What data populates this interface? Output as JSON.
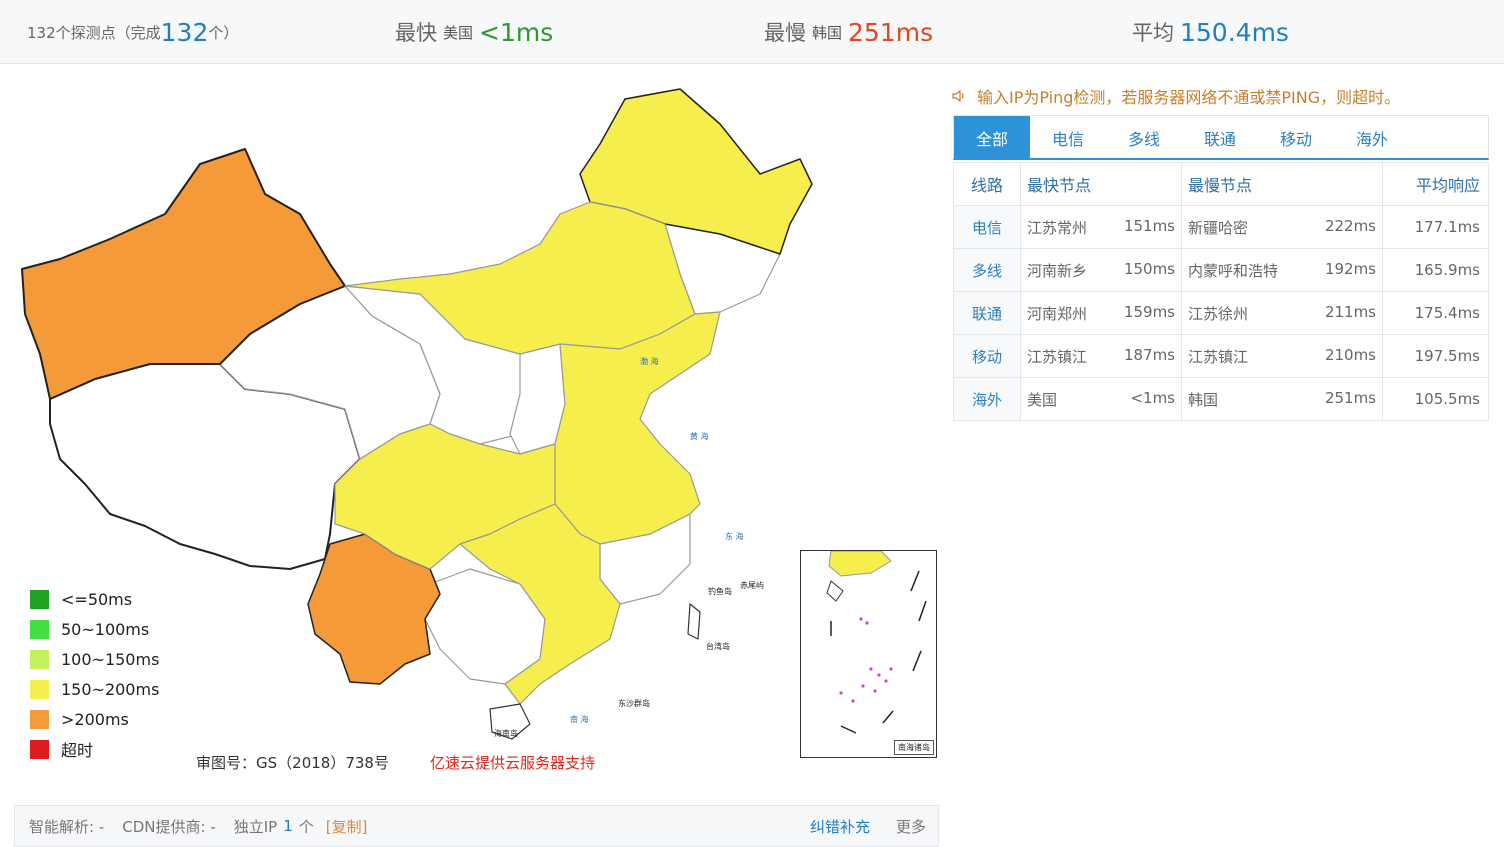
{
  "summary": {
    "probe_text": "132个探测点（完成",
    "probe_done": "132",
    "probe_suffix": "个）",
    "fastest_label": "最快",
    "fastest_country": "美国",
    "fastest_value": "<1ms",
    "slowest_label": "最慢",
    "slowest_country": "韩国",
    "slowest_value": "251ms",
    "avg_label": "平均",
    "avg_value": "150.4ms"
  },
  "legend": [
    {
      "label": "<=50ms",
      "color": "#22a022"
    },
    {
      "label": "50~100ms",
      "color": "#44dd44"
    },
    {
      "label": "100~150ms",
      "color": "#c4f15a"
    },
    {
      "label": "150~200ms",
      "color": "#f5ee4c"
    },
    {
      "label": ">200ms",
      "color": "#f59a38"
    },
    {
      "label": "超时",
      "color": "#e01b1b"
    }
  ],
  "map": {
    "credit": "审图号：GS（2018）738号",
    "sponsor": "亿速云提供云服务器支持",
    "inset_caption": "南海诸岛"
  },
  "bottom": {
    "dns_label": "智能解析: -",
    "cdn_label": "CDN提供商: -",
    "ip_label": "独立IP",
    "ip_count": "1",
    "ip_unit": "个",
    "copy_label": "[复制]",
    "fix_label": "纠错补充",
    "more_label": "更多"
  },
  "hint": "输入IP为Ping检测，若服务器网络不通或禁PING，则超时。",
  "tabs": [
    "全部",
    "电信",
    "多线",
    "联通",
    "移动",
    "海外"
  ],
  "table": {
    "headers": {
      "line": "线路",
      "fastest": "最快节点",
      "slowest": "最慢节点",
      "avg": "平均响应"
    },
    "rows": [
      {
        "line": "电信",
        "fast_node": "江苏常州",
        "fast_ms": "151ms",
        "slow_node": "新疆哈密",
        "slow_ms": "222ms",
        "avg": "177.1ms"
      },
      {
        "line": "多线",
        "fast_node": "河南新乡",
        "fast_ms": "150ms",
        "slow_node": "内蒙呼和浩特",
        "slow_ms": "192ms",
        "avg": "165.9ms"
      },
      {
        "line": "联通",
        "fast_node": "河南郑州",
        "fast_ms": "159ms",
        "slow_node": "江苏徐州",
        "slow_ms": "211ms",
        "avg": "175.4ms"
      },
      {
        "line": "移动",
        "fast_node": "江苏镇江",
        "fast_ms": "187ms",
        "slow_node": "江苏镇江",
        "slow_ms": "210ms",
        "avg": "197.5ms"
      },
      {
        "line": "海外",
        "fast_node": "美国",
        "fast_ms": "<1ms",
        "slow_node": "韩国",
        "slow_ms": "251ms",
        "avg": "105.5ms"
      }
    ]
  }
}
